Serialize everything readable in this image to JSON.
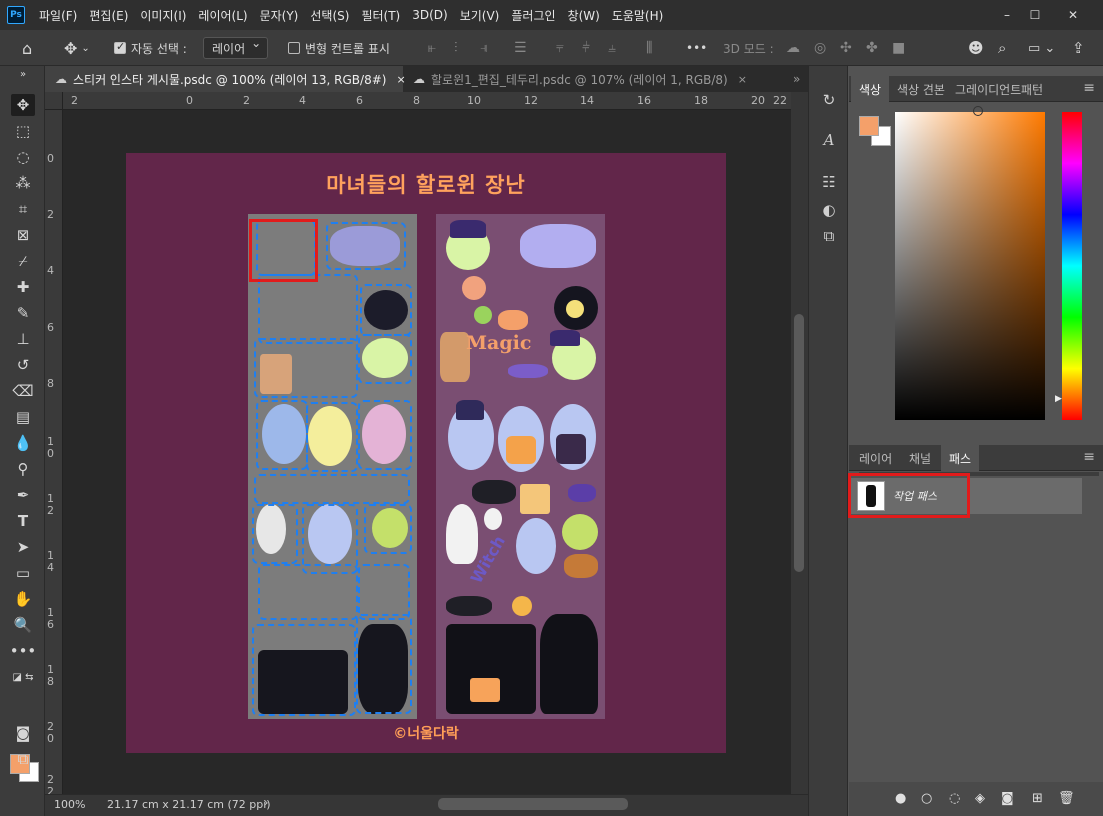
{
  "app": {
    "logo": "Ps"
  },
  "menu": [
    "파일(F)",
    "편집(E)",
    "이미지(I)",
    "레이어(L)",
    "문자(Y)",
    "선택(S)",
    "필터(T)",
    "3D(D)",
    "보기(V)",
    "플러그인",
    "창(W)",
    "도움말(H)"
  ],
  "window_controls": {
    "minimize": "–",
    "restore": "☐",
    "close": "✕"
  },
  "options": {
    "auto_select_label": "자동 선택 :",
    "auto_select_value": "레이어",
    "transform_label": "변형 컨트롤 표시",
    "more": "•••",
    "mode_3d_label": "3D 모드 :"
  },
  "tabs": [
    {
      "label": "스티커 인스타 게시물.psdc @ 100% (레이어 13, RGB/8#)",
      "close": "×"
    },
    {
      "label": "할로윈1_편집_테두리.psdc @ 107% (레이어 1, RGB/8)",
      "close": "×"
    }
  ],
  "ruler_top": [
    "2",
    "0",
    "2",
    "4",
    "6",
    "8",
    "10",
    "12",
    "14",
    "16",
    "18",
    "20",
    "22"
  ],
  "ruler_left": [
    "0",
    "2",
    "4",
    "6",
    "8",
    "1\n0",
    "1\n2",
    "1\n4",
    "1\n6",
    "1\n8",
    "2\n0",
    "2\n2"
  ],
  "document": {
    "title": "마녀들의 할로윈 장난",
    "signature": "©너울다락",
    "magic_text": "Magic",
    "witch_text": "Witch"
  },
  "status": {
    "zoom": "100%",
    "size": "21.17 cm x 21.17 cm (72 ppi)",
    "arrow": "›"
  },
  "color_panel": {
    "tabs": [
      "색상",
      "색상 견본",
      "그레이디언트",
      "패턴"
    ],
    "foreground": "#f4a06a",
    "background": "#ffffff"
  },
  "layers_panel": {
    "tabs": [
      "레이어",
      "채널",
      "패스"
    ],
    "path_name": "작업 패스",
    "footer_icons": [
      "●",
      "○",
      "◌",
      "◈",
      "◙",
      "⊞",
      "🗑"
    ]
  }
}
